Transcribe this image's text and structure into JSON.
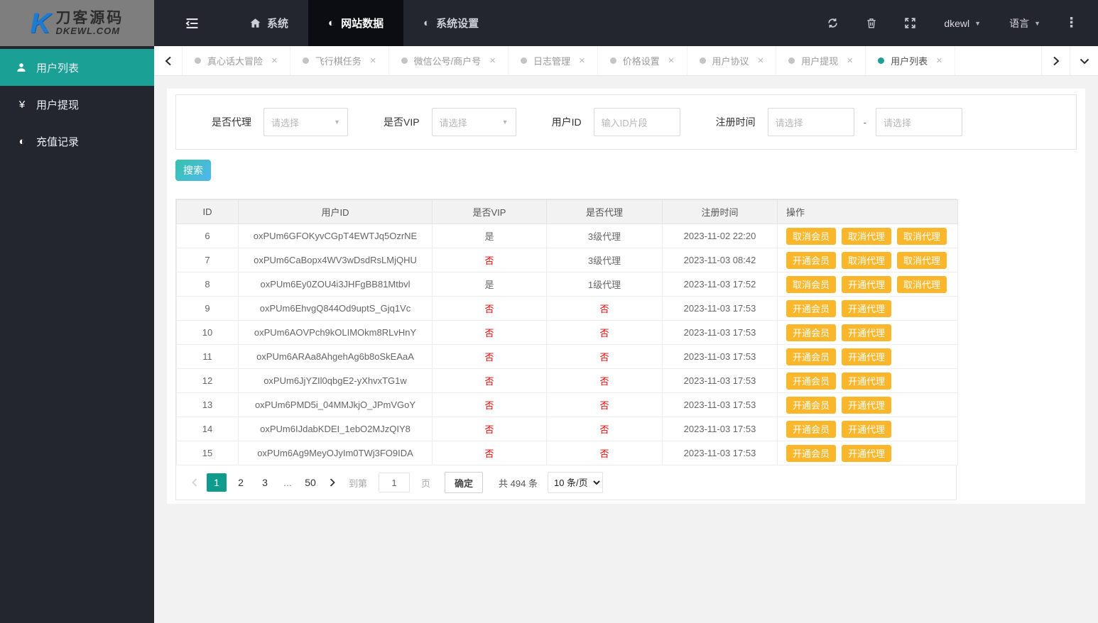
{
  "brand": {
    "name": "刀客源码",
    "domain": "DKEWL.COM",
    "mark": "K"
  },
  "topnav": {
    "menu": [
      {
        "label": "系统",
        "icon": "home-icon",
        "active": false
      },
      {
        "label": "网站数据",
        "icon": "contrast-icon",
        "active": true
      },
      {
        "label": "系统设置",
        "icon": "contrast-icon",
        "active": false
      }
    ],
    "contrast_glyph": "◐",
    "username": "dkewl",
    "language_label": "语言",
    "dots_glyph": "⋮"
  },
  "sidebar": {
    "items": [
      {
        "label": "用户列表",
        "icon": "user-icon",
        "active": true
      },
      {
        "label": "用户提现",
        "icon": "yen-icon",
        "active": false
      },
      {
        "label": "充值记录",
        "icon": "contrast-icon",
        "active": false
      }
    ],
    "yen_glyph": "¥",
    "contrast_glyph": "◐"
  },
  "tabbar": {
    "tabs": [
      {
        "label": "真心话大冒险",
        "active": false
      },
      {
        "label": "飞行棋任务",
        "active": false
      },
      {
        "label": "微信公号/商户号",
        "active": false
      },
      {
        "label": "日志管理",
        "active": false
      },
      {
        "label": "价格设置",
        "active": false
      },
      {
        "label": "用户协议",
        "active": false
      },
      {
        "label": "用户提现",
        "active": false
      },
      {
        "label": "用户列表",
        "active": true
      }
    ],
    "close_glyph": "×"
  },
  "filters": {
    "agent": {
      "label": "是否代理",
      "placeholder": "请选择"
    },
    "vip": {
      "label": "是否VIP",
      "placeholder": "请选择"
    },
    "user_id": {
      "label": "用户ID",
      "placeholder": "输入ID片段"
    },
    "reg_time": {
      "label": "注册时间",
      "from_placeholder": "请选择",
      "to_placeholder": "请选择",
      "separator": "-"
    }
  },
  "search_label": "搜索",
  "table": {
    "headers": [
      "ID",
      "用户ID",
      "是否VIP",
      "是否代理",
      "注册时间",
      "操作"
    ],
    "negative_value": "否",
    "rows": [
      {
        "id": "6",
        "user_id": "oxPUm6GFOKyvCGpT4EWTJq5OzrNE",
        "vip": "是",
        "agent": "3级代理",
        "reg_time": "2023-11-02 22:20",
        "actions": [
          "取消会员",
          "取消代理",
          "取消代理"
        ]
      },
      {
        "id": "7",
        "user_id": "oxPUm6CaBopx4WV3wDsdRsLMjQHU",
        "vip": "否",
        "agent": "3级代理",
        "reg_time": "2023-11-03 08:42",
        "actions": [
          "开通会员",
          "取消代理",
          "取消代理"
        ]
      },
      {
        "id": "8",
        "user_id": "oxPUm6Ey0ZOU4i3JHFgBB81Mtbvl",
        "vip": "是",
        "agent": "1级代理",
        "reg_time": "2023-11-03 17:52",
        "actions": [
          "取消会员",
          "开通代理",
          "取消代理"
        ]
      },
      {
        "id": "9",
        "user_id": "oxPUm6EhvgQ844Od9uptS_Gjq1Vc",
        "vip": "否",
        "agent": "否",
        "reg_time": "2023-11-03 17:53",
        "actions": [
          "开通会员",
          "开通代理"
        ]
      },
      {
        "id": "10",
        "user_id": "oxPUm6AOVPch9kOLIMOkm8RLvHnY",
        "vip": "否",
        "agent": "否",
        "reg_time": "2023-11-03 17:53",
        "actions": [
          "开通会员",
          "开通代理"
        ]
      },
      {
        "id": "11",
        "user_id": "oxPUm6ARAa8AhgehAg6b8oSkEAaA",
        "vip": "否",
        "agent": "否",
        "reg_time": "2023-11-03 17:53",
        "actions": [
          "开通会员",
          "开通代理"
        ]
      },
      {
        "id": "12",
        "user_id": "oxPUm6JjYZIl0qbgE2-yXhvxTG1w",
        "vip": "否",
        "agent": "否",
        "reg_time": "2023-11-03 17:53",
        "actions": [
          "开通会员",
          "开通代理"
        ]
      },
      {
        "id": "13",
        "user_id": "oxPUm6PMD5i_04MMJkjO_JPmVGoY",
        "vip": "否",
        "agent": "否",
        "reg_time": "2023-11-03 17:53",
        "actions": [
          "开通会员",
          "开通代理"
        ]
      },
      {
        "id": "14",
        "user_id": "oxPUm6IJdabKDEI_1ebO2MJzQIY8",
        "vip": "否",
        "agent": "否",
        "reg_time": "2023-11-03 17:53",
        "actions": [
          "开通会员",
          "开通代理"
        ]
      },
      {
        "id": "15",
        "user_id": "oxPUm6Ag9MeyOJyIm0TWj3FO9IDA",
        "vip": "否",
        "agent": "否",
        "reg_time": "2023-11-03 17:53",
        "actions": [
          "开通会员",
          "开通代理"
        ]
      }
    ]
  },
  "pagination": {
    "pages": [
      {
        "label": "1",
        "active": true
      },
      {
        "label": "2",
        "active": false
      },
      {
        "label": "3",
        "active": false
      },
      {
        "label": "...",
        "ellipsis": true
      },
      {
        "label": "50",
        "active": false
      }
    ],
    "goto_prefix": "到第",
    "goto_value": "1",
    "goto_suffix": "页",
    "confirm_label": "确定",
    "total_label": "共 494 条",
    "page_size_label": "10 条/页"
  },
  "colors": {
    "accent_teal": "#1aa094",
    "pager_active_teal": "#0f9c8c",
    "action_orange": "#fbb72c",
    "negative_red": "#f00000",
    "nav_dark": "#23262e",
    "nav_active_dark": "#0c0d12"
  }
}
